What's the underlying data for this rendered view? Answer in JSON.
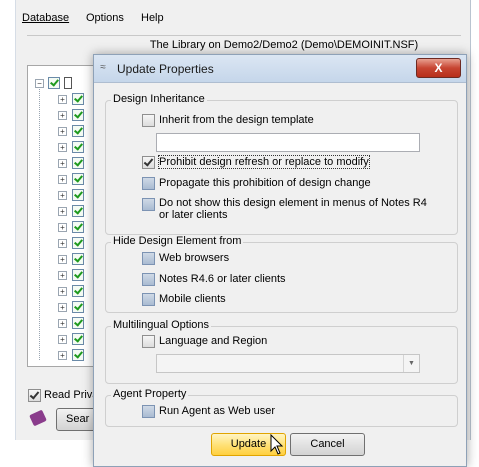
{
  "menu": {
    "database": "Database",
    "options": "Options",
    "help": "Help"
  },
  "library_bar": "The Library on Demo2/Demo2 (Demo\\DEMOINIT.NSF)",
  "bottom": {
    "read_private": "Read Priva",
    "search": "Sear"
  },
  "dialog": {
    "title": "Update Properties",
    "close": "X",
    "design_inheritance": {
      "label": "Design Inheritance",
      "inherit": "Inherit from the design template",
      "inherit_value": "",
      "prohibit": "Prohibit design refresh or replace to modify",
      "propagate": "Propagate this prohibition of design change",
      "do_not_show": "Do not show this design element in menus of Notes R4 or later clients"
    },
    "hide_from": {
      "label": "Hide Design Element from",
      "web": "Web browsers",
      "notes": "Notes R4.6 or later clients",
      "mobile": "Mobile clients"
    },
    "multilingual": {
      "label": "Multilingual Options",
      "language": "Language and Region",
      "select_value": ""
    },
    "agent": {
      "label": "Agent Property",
      "run_as_web": "Run Agent as Web user"
    },
    "update_button": "Update",
    "cancel_button": "Cancel"
  }
}
